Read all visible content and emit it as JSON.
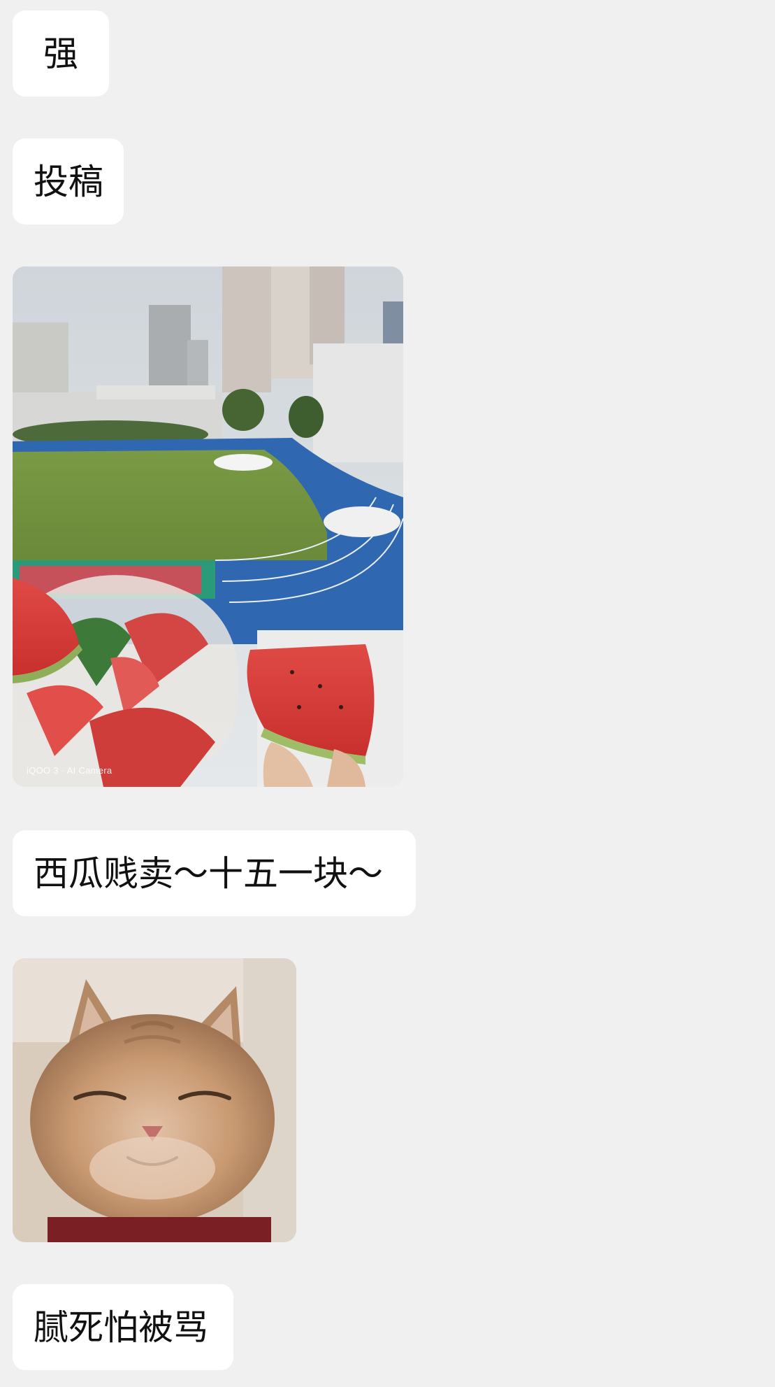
{
  "messages": [
    {
      "type": "text",
      "text": "强"
    },
    {
      "type": "text",
      "text": "投稿"
    },
    {
      "type": "image",
      "subject": "watermelon-photo",
      "watermark": "iQOO 3 · AI Camera"
    },
    {
      "type": "text",
      "text": "西瓜贱卖～十五一块～"
    },
    {
      "type": "image",
      "subject": "smiling-cat-photo"
    },
    {
      "type": "text",
      "text": "腻死怕被骂"
    }
  ],
  "colors": {
    "background": "#f0f0f0",
    "bubble": "#ffffff",
    "text": "#111111"
  }
}
